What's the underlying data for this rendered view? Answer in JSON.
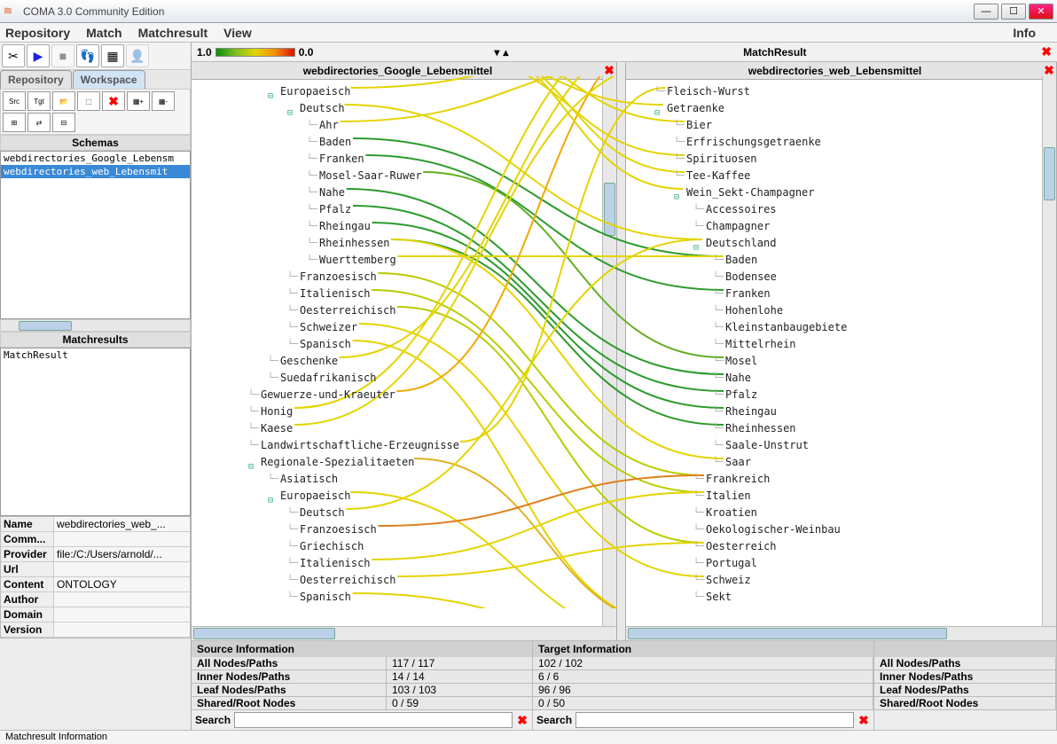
{
  "window": {
    "title": "COMA 3.0 Community Edition"
  },
  "menu": {
    "items": [
      "Repository",
      "Match",
      "Matchresult",
      "View"
    ],
    "info": "Info"
  },
  "gradient": {
    "high": "1.0",
    "low": "0.0",
    "mr_title": "MatchResult"
  },
  "sidebar": {
    "tabs": {
      "repository": "Repository",
      "workspace": "Workspace"
    },
    "schemas_label": "Schemas",
    "schemas": [
      "webdirectories_Google_Lebensm",
      "webdirectories_web_Lebensmit"
    ],
    "matchresults_label": "Matchresults",
    "matchresults": [
      "MatchResult"
    ],
    "props": [
      {
        "label": "Name",
        "value": "webdirectories_web_..."
      },
      {
        "label": "Comm...",
        "value": ""
      },
      {
        "label": "Provider",
        "value": "file:/C:/Users/arnold/..."
      },
      {
        "label": "Url",
        "value": ""
      },
      {
        "label": "Content",
        "value": "ONTOLOGY"
      },
      {
        "label": "Author",
        "value": ""
      },
      {
        "label": "Domain",
        "value": ""
      },
      {
        "label": "Version",
        "value": ""
      }
    ]
  },
  "left_tree": {
    "title": "webdirectories_Google_Lebensmittel",
    "nodes": [
      {
        "d": 3,
        "h": true,
        "t": "Europaeisch"
      },
      {
        "d": 4,
        "h": true,
        "t": "Deutsch"
      },
      {
        "d": 5,
        "h": false,
        "t": "Ahr"
      },
      {
        "d": 5,
        "h": false,
        "t": "Baden"
      },
      {
        "d": 5,
        "h": false,
        "t": "Franken"
      },
      {
        "d": 5,
        "h": false,
        "t": "Mosel-Saar-Ruwer"
      },
      {
        "d": 5,
        "h": false,
        "t": "Nahe"
      },
      {
        "d": 5,
        "h": false,
        "t": "Pfalz"
      },
      {
        "d": 5,
        "h": false,
        "t": "Rheingau"
      },
      {
        "d": 5,
        "h": false,
        "t": "Rheinhessen"
      },
      {
        "d": 5,
        "h": false,
        "t": "Wuerttemberg"
      },
      {
        "d": 4,
        "h": false,
        "t": "Franzoesisch"
      },
      {
        "d": 4,
        "h": false,
        "t": "Italienisch"
      },
      {
        "d": 4,
        "h": false,
        "t": "Oesterreichisch"
      },
      {
        "d": 4,
        "h": false,
        "t": "Schweizer"
      },
      {
        "d": 4,
        "h": false,
        "t": "Spanisch"
      },
      {
        "d": 3,
        "h": false,
        "t": "Geschenke"
      },
      {
        "d": 3,
        "h": false,
        "t": "Suedafrikanisch"
      },
      {
        "d": 2,
        "h": false,
        "t": "Gewuerze-und-Kraeuter"
      },
      {
        "d": 2,
        "h": false,
        "t": "Honig"
      },
      {
        "d": 2,
        "h": false,
        "t": "Kaese"
      },
      {
        "d": 2,
        "h": false,
        "t": "Landwirtschaftliche-Erzeugnisse"
      },
      {
        "d": 2,
        "h": true,
        "t": "Regionale-Spezialitaeten"
      },
      {
        "d": 3,
        "h": false,
        "t": "Asiatisch"
      },
      {
        "d": 3,
        "h": true,
        "t": "Europaeisch"
      },
      {
        "d": 4,
        "h": false,
        "t": "Deutsch"
      },
      {
        "d": 4,
        "h": false,
        "t": "Franzoesisch"
      },
      {
        "d": 4,
        "h": false,
        "t": "Griechisch"
      },
      {
        "d": 4,
        "h": false,
        "t": "Italienisch"
      },
      {
        "d": 4,
        "h": false,
        "t": "Oesterreichisch"
      },
      {
        "d": 4,
        "h": false,
        "t": "Spanisch"
      }
    ]
  },
  "right_tree": {
    "title": "webdirectories_web_Lebensmittel",
    "nodes": [
      {
        "d": 1,
        "h": false,
        "t": "Fleisch-Wurst"
      },
      {
        "d": 1,
        "h": true,
        "t": "Getraenke"
      },
      {
        "d": 2,
        "h": false,
        "t": "Bier"
      },
      {
        "d": 2,
        "h": false,
        "t": "Erfrischungsgetraenke"
      },
      {
        "d": 2,
        "h": false,
        "t": "Spirituosen"
      },
      {
        "d": 2,
        "h": false,
        "t": "Tee-Kaffee"
      },
      {
        "d": 2,
        "h": true,
        "t": "Wein_Sekt-Champagner"
      },
      {
        "d": 3,
        "h": false,
        "t": "Accessoires"
      },
      {
        "d": 3,
        "h": false,
        "t": "Champagner"
      },
      {
        "d": 3,
        "h": true,
        "t": "Deutschland"
      },
      {
        "d": 4,
        "h": false,
        "t": "Baden"
      },
      {
        "d": 4,
        "h": false,
        "t": "Bodensee"
      },
      {
        "d": 4,
        "h": false,
        "t": "Franken"
      },
      {
        "d": 4,
        "h": false,
        "t": "Hohenlohe"
      },
      {
        "d": 4,
        "h": false,
        "t": "Kleinstanbaugebiete"
      },
      {
        "d": 4,
        "h": false,
        "t": "Mittelrhein"
      },
      {
        "d": 4,
        "h": false,
        "t": "Mosel"
      },
      {
        "d": 4,
        "h": false,
        "t": "Nahe"
      },
      {
        "d": 4,
        "h": false,
        "t": "Pfalz"
      },
      {
        "d": 4,
        "h": false,
        "t": "Rheingau"
      },
      {
        "d": 4,
        "h": false,
        "t": "Rheinhessen"
      },
      {
        "d": 4,
        "h": false,
        "t": "Saale-Unstrut"
      },
      {
        "d": 4,
        "h": false,
        "t": "Saar"
      },
      {
        "d": 3,
        "h": false,
        "t": "Frankreich"
      },
      {
        "d": 3,
        "h": false,
        "t": "Italien"
      },
      {
        "d": 3,
        "h": false,
        "t": "Kroatien"
      },
      {
        "d": 3,
        "h": false,
        "t": "Oekologischer-Weinbau"
      },
      {
        "d": 3,
        "h": false,
        "t": "Oesterreich"
      },
      {
        "d": 3,
        "h": false,
        "t": "Portugal"
      },
      {
        "d": 3,
        "h": false,
        "t": "Schweiz"
      },
      {
        "d": 3,
        "h": false,
        "t": "Sekt"
      }
    ]
  },
  "source_info": {
    "header": "Source Information",
    "lines": [
      {
        "label": "All Nodes/Paths",
        "value": "117 / 117"
      },
      {
        "label": "Inner Nodes/Paths",
        "value": "14 / 14"
      },
      {
        "label": "Leaf Nodes/Paths",
        "value": "103 / 103"
      },
      {
        "label": "Shared/Root Nodes",
        "value": "0 / 59"
      }
    ]
  },
  "target_info": {
    "header": "Target Information",
    "lines": [
      {
        "label": "",
        "value": "102 / 102"
      },
      {
        "label": "",
        "value": "6 / 6"
      },
      {
        "label": "",
        "value": "96 / 96"
      },
      {
        "label": "",
        "value": "0 / 50"
      }
    ]
  },
  "right_labels": [
    "All Nodes/Paths",
    "Inner Nodes/Paths",
    "Leaf Nodes/Paths",
    "Shared/Root Nodes"
  ],
  "search": {
    "label": "Search"
  },
  "status": "Matchresult Information",
  "matches": [
    {
      "l": 0,
      "r": -2,
      "c": "#e4d400"
    },
    {
      "l": 1,
      "r": 9,
      "c": "#e4d400"
    },
    {
      "l": 2,
      "r": -1,
      "c": "#e4d400"
    },
    {
      "l": 3,
      "r": 10,
      "c": "#2b9b2b"
    },
    {
      "l": 4,
      "r": 12,
      "c": "#2b9b2b"
    },
    {
      "l": 5,
      "r": 16,
      "c": "#61b020"
    },
    {
      "l": 6,
      "r": 17,
      "c": "#2b9b2b"
    },
    {
      "l": 7,
      "r": 18,
      "c": "#2b9b2b"
    },
    {
      "l": 8,
      "r": 19,
      "c": "#2b9b2b"
    },
    {
      "l": 9,
      "r": 20,
      "c": "#2b9b2b"
    },
    {
      "l": 10,
      "r": 10,
      "c": "#e4d400"
    },
    {
      "l": 11,
      "r": 23,
      "c": "#b8cc00"
    },
    {
      "l": 12,
      "r": 24,
      "c": "#b8cc00"
    },
    {
      "l": 13,
      "r": 27,
      "c": "#b8cc00"
    },
    {
      "l": 14,
      "r": 29,
      "c": "#e4d400"
    },
    {
      "l": 15,
      "r": 32,
      "c": "#e4d400"
    },
    {
      "l": 16,
      "r": -3,
      "c": "#e4d400"
    },
    {
      "l": 18,
      "r": -3,
      "c": "#f2a800"
    },
    {
      "l": 19,
      "r": -4,
      "c": "#e4d400"
    },
    {
      "l": 20,
      "r": -1,
      "c": "#e4d400"
    },
    {
      "l": 21,
      "r": 0,
      "c": "#e4d400"
    },
    {
      "l": 22,
      "r": 32,
      "c": "#e0b020"
    },
    {
      "l": 24,
      "r": 33,
      "c": "#e4d400"
    },
    {
      "l": 25,
      "r": 9,
      "c": "#e4d400"
    },
    {
      "l": 26,
      "r": 23,
      "c": "#e08020"
    },
    {
      "l": 28,
      "r": 24,
      "c": "#e4d400"
    },
    {
      "l": 29,
      "r": 27,
      "c": "#e4d400"
    },
    {
      "l": 30,
      "r": 33,
      "c": "#e4d400"
    },
    {
      "l": -1,
      "r": 1,
      "c": "#e4d400"
    },
    {
      "l": -2,
      "r": 2,
      "c": "#e4d400"
    },
    {
      "l": -1,
      "r": 4,
      "c": "#e4d400"
    },
    {
      "l": -2,
      "r": 5,
      "c": "#e4d400"
    },
    {
      "l": -2,
      "r": 6,
      "c": "#e4d400"
    },
    {
      "l": 9,
      "r": 22,
      "c": "#e4d400"
    }
  ]
}
